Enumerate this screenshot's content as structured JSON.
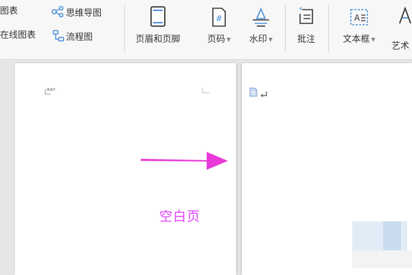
{
  "ribbon": {
    "left_group": {
      "row1_text": "图表",
      "row2_text": "在线图表",
      "mindmap_label": "思维导图",
      "flowchart_label": "流程图"
    },
    "tools": {
      "header_footer": "页眉和页脚",
      "page_number": "页码",
      "watermark": "水印",
      "comment": "批注",
      "textbox": "文本框",
      "art": "艺术"
    }
  },
  "document": {
    "annotation_label": "空白页",
    "annotation_color": "#e040fb",
    "left_page_fragment": "aar."
  },
  "colors": {
    "accent_blue": "#4a90d9",
    "arrow_magenta": "#e83ad8"
  }
}
